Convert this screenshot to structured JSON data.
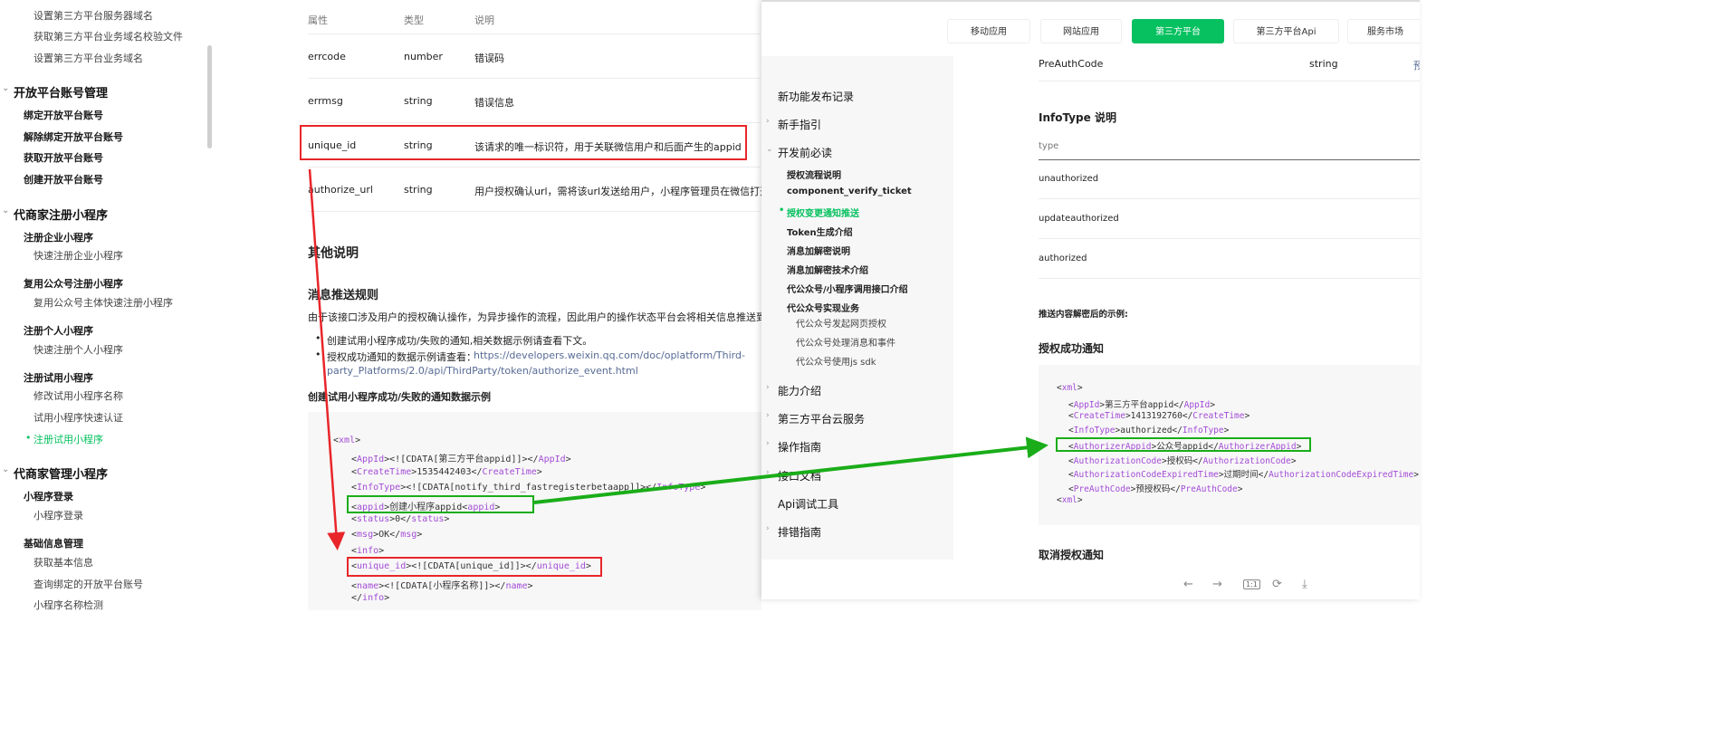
{
  "left_sidebar": {
    "items": [
      {
        "label": "设置第三方平台服务器域名",
        "level": 3
      },
      {
        "label": "获取第三方平台业务域名校验文件",
        "level": 3
      },
      {
        "label": "设置第三方平台业务域名",
        "level": 3
      },
      {
        "label": "开放平台账号管理",
        "level": 1
      },
      {
        "label": "绑定开放平台账号",
        "level": 2
      },
      {
        "label": "解除绑定开放平台账号",
        "level": 2
      },
      {
        "label": "获取开放平台账号",
        "level": 2
      },
      {
        "label": "创建开放平台账号",
        "level": 2
      },
      {
        "label": "代商家注册小程序",
        "level": 1
      },
      {
        "label": "注册企业小程序",
        "level": 2
      },
      {
        "label": "快速注册企业小程序",
        "level": 3
      },
      {
        "label": "复用公众号注册小程序",
        "level": 2
      },
      {
        "label": "复用公众号主体快速注册小程序",
        "level": 3
      },
      {
        "label": "注册个人小程序",
        "level": 2
      },
      {
        "label": "快速注册个人小程序",
        "level": 3
      },
      {
        "label": "注册试用小程序",
        "level": 2
      },
      {
        "label": "修改试用小程序名称",
        "level": 3
      },
      {
        "label": "试用小程序快速认证",
        "level": 3
      },
      {
        "label": "注册试用小程序",
        "level": 3,
        "active": true
      },
      {
        "label": "代商家管理小程序",
        "level": 1
      },
      {
        "label": "小程序登录",
        "level": 2
      },
      {
        "label": "小程序登录",
        "level": 3
      },
      {
        "label": "基础信息管理",
        "level": 2
      },
      {
        "label": "获取基本信息",
        "level": 3
      },
      {
        "label": "查询绑定的开放平台账号",
        "level": 3
      },
      {
        "label": "小程序名称检测",
        "level": 3
      }
    ],
    "active_dot": "•"
  },
  "main": {
    "table_headers": [
      "属性",
      "类型",
      "说明"
    ],
    "rows": [
      {
        "name": "errcode",
        "type": "number",
        "desc": "错误码"
      },
      {
        "name": "errmsg",
        "type": "string",
        "desc": "错误信息"
      },
      {
        "name": "unique_id",
        "type": "string",
        "desc": "该请求的唯一标识符，用于关联微信用户和后面产生的appid"
      },
      {
        "name": "authorize_url",
        "type": "string",
        "desc": "用户授权确认url，需将该url发送给用户，小程序管理员在微信打开"
      }
    ],
    "other_title": "其他说明",
    "push_title": "消息推送规则",
    "push_desc": "由于该接口涉及用户的授权确认操作，为异步操作的流程，因此用户的操作状态平台会将相关信息推送到",
    "bullet1": "创建试用小程序成功/失败的通知,相关数据示例请查看下文。",
    "bullet2_prefix": "授权成功通知的数据示例请查看：",
    "bullet2_link_line1": "https://developers.weixin.qq.com/doc/oplatform/Third-",
    "bullet2_link_line2": "party_Platforms/2.0/api/ThirdParty/token/authorize_event.html",
    "example_title": "创建试用小程序成功/失败的通知数据示例",
    "code_lines": [
      "<xml>",
      "  <AppId><![CDATA[第三方平台appid]]></AppId>",
      "  <CreateTime>1535442403</CreateTime>",
      "  <InfoType><![CDATA[notify_third_fastregisterbetaapp]]></InfoType>",
      "  <appid>创建小程序appid<appid>",
      "  <status>0</status>",
      "  <msg>OK</msg>",
      "  <info>",
      "  <unique_id><![CDATA[unique_id]]></unique_id>",
      "  <name><![CDATA[小程序名称]]></name>",
      "  </info>"
    ]
  },
  "overlay": {
    "tabs": [
      {
        "label": "移动应用",
        "active": false
      },
      {
        "label": "网站应用",
        "active": false
      },
      {
        "label": "第三方平台",
        "active": true
      },
      {
        "label": "第三方平台Api",
        "active": false
      },
      {
        "label": "服务市场",
        "active": false
      }
    ],
    "nav": [
      {
        "label": "新功能发布记录",
        "kind": "top",
        "chevron": ""
      },
      {
        "label": "新手指引",
        "kind": "top",
        "chevron": "›"
      },
      {
        "label": "开发前必读",
        "kind": "top",
        "chevron": "⌄"
      },
      {
        "label": "授权流程说明",
        "kind": "sub"
      },
      {
        "label": "component_verify_ticket",
        "kind": "sub"
      },
      {
        "label": "授权变更通知推送",
        "kind": "sub",
        "active": true
      },
      {
        "label": "Token生成介绍",
        "kind": "sub"
      },
      {
        "label": "消息加解密说明",
        "kind": "sub"
      },
      {
        "label": "消息加解密技术介绍",
        "kind": "sub"
      },
      {
        "label": "代公众号/小程序调用接口介绍",
        "kind": "sub"
      },
      {
        "label": "代公众号实现业务",
        "kind": "sub"
      },
      {
        "label": "代公众号发起网页授权",
        "kind": "sub2"
      },
      {
        "label": "代公众号处理消息和事件",
        "kind": "sub2"
      },
      {
        "label": "代公众号使用js sdk",
        "kind": "sub2"
      },
      {
        "label": "能力介绍",
        "kind": "top",
        "chevron": "›"
      },
      {
        "label": "第三方平台云服务",
        "kind": "top",
        "chevron": "›"
      },
      {
        "label": "操作指南",
        "kind": "top",
        "chevron": "›"
      },
      {
        "label": "接口文档",
        "kind": "top",
        "chevron": "›"
      },
      {
        "label": "Api调试工具",
        "kind": "top",
        "chevron": ""
      },
      {
        "label": "排错指南",
        "kind": "top",
        "chevron": "›"
      }
    ],
    "content": {
      "preauth_name": "PreAuthCode",
      "preauth_type": "string",
      "preauth_desc": "预",
      "infotype_title": "InfoType 说明",
      "col_type": "type",
      "types": [
        "unauthorized",
        "updateauthorized",
        "authorized"
      ],
      "decrypted_example": "推送内容解密后的示例:",
      "success_title": "授权成功通知",
      "code_lines": [
        "<xml>",
        "  <AppId>第三方平台appid</AppId>",
        "  <CreateTime>1413192760</CreateTime>",
        "  <InfoType>authorized</InfoType>",
        "  <AuthorizerAppid>公众号appid</AuthorizerAppid>",
        "  <AuthorizationCode>授权码</AuthorizationCode>",
        "  <AuthorizationCodeExpiredTime>过期时间</AuthorizationCodeExpiredTime>",
        "  <PreAuthCode>预授权码</PreAuthCode>",
        "<xml>"
      ],
      "cancel_title": "取消授权通知"
    },
    "toolbar": {
      "prev": "←",
      "next": "→",
      "actual_size": "1:1",
      "rotate": "⟳",
      "download": "⤓"
    }
  },
  "colors": {
    "accent_green": "#07c160",
    "annotation_red": "#e8262a",
    "annotation_green": "#1aad19",
    "xml_tag": "#a34cd6"
  }
}
